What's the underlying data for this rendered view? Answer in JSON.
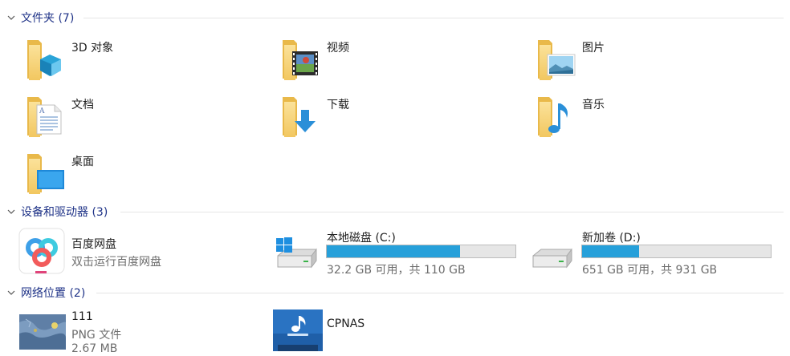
{
  "groups": {
    "folders": {
      "title": "文件夹 (7)"
    },
    "devices": {
      "title": "设备和驱动器 (3)"
    },
    "network": {
      "title": "网络位置 (2)"
    }
  },
  "folders": [
    {
      "label": "3D 对象",
      "icon": "3d-objects-folder-icon"
    },
    {
      "label": "视频",
      "icon": "videos-folder-icon"
    },
    {
      "label": "图片",
      "icon": "pictures-folder-icon"
    },
    {
      "label": "文档",
      "icon": "documents-folder-icon"
    },
    {
      "label": "下载",
      "icon": "downloads-folder-icon"
    },
    {
      "label": "音乐",
      "icon": "music-folder-icon"
    },
    {
      "label": "桌面",
      "icon": "desktop-folder-icon"
    }
  ],
  "devices": [
    {
      "label": "百度网盘",
      "subtitle": "双击运行百度网盘",
      "icon": "baidu-netdisk-icon"
    },
    {
      "label": "本地磁盘 (C:)",
      "usage_text": "32.2 GB 可用，共 110 GB",
      "used_fraction": 0.707,
      "icon": "windows-drive-icon"
    },
    {
      "label": "新加卷 (D:)",
      "usage_text": "651 GB 可用，共 931 GB",
      "used_fraction": 0.301,
      "icon": "drive-icon"
    }
  ],
  "network": [
    {
      "label": "111",
      "subtitle": "PNG 文件",
      "subtitle2": "2.67 MB",
      "icon": "map-thumbnail-icon"
    },
    {
      "label": "CPNAS",
      "icon": "nas-media-icon"
    }
  ],
  "colors": {
    "group_title": "#1e3287",
    "usage_bar": "#26a0da",
    "folder": "#f8d775"
  }
}
